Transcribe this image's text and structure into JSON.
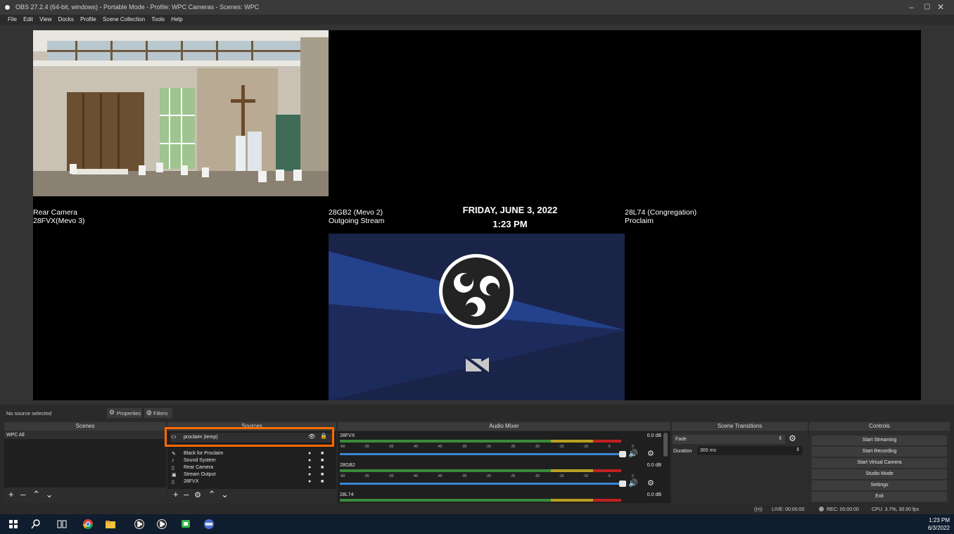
{
  "window": {
    "title": "OBS 27.2.4 (64-bit, windows) - Portable Mode - Profile: WPC Cameras - Scenes: WPC",
    "min": "–",
    "max": "▢",
    "close": "✕"
  },
  "menu": [
    "File",
    "Edit",
    "View",
    "Docks",
    "Profile",
    "Scene Collection",
    "Tools",
    "Help"
  ],
  "preview": {
    "left_label_1": "Rear Camera",
    "left_label_2": "28FVX(Mevo 3)",
    "mid_label_1": "28GB2 (Mevo 2)",
    "mid_label_2": "Outgoing Stream",
    "date": "FRIDAY, JUNE 3, 2022",
    "time": "1:23 PM",
    "right_label_1": "28L74 (Congregation)",
    "right_label_2": "Proclaim"
  },
  "propbar": {
    "status": "No source selected",
    "properties": "Properties",
    "filters": "Filters"
  },
  "scenes": {
    "header": "Scenes",
    "items": [
      "WPC All"
    ]
  },
  "sources": {
    "header": "Sources",
    "items": [
      "proclaim )temp)",
      "Black for Proclaim",
      "Sound System",
      "Rear Camera",
      "Stream Output",
      "28FVX"
    ]
  },
  "mixer": {
    "header": "Audio Mixer",
    "channels": [
      {
        "name": "28FVX",
        "db": "0.0 dB"
      },
      {
        "name": "28GB2",
        "db": "0.0 dB"
      },
      {
        "name": "28L74",
        "db": "0.0 dB"
      }
    ],
    "scale": [
      "-60",
      "-55",
      "-50",
      "-45",
      "-40",
      "-35",
      "-30",
      "-25",
      "-20",
      "-15",
      "-10",
      "-5",
      "0"
    ]
  },
  "transitions": {
    "header": "Scene Transitions",
    "selected": "Fade",
    "duration_label": "Duration",
    "duration_value": "300 ms"
  },
  "controls": {
    "header": "Controls",
    "buttons": [
      "Start Streaming",
      "Start Recording",
      "Start Virtual Camera",
      "Studio Mode",
      "Settings",
      "Exit"
    ]
  },
  "status": {
    "live": "LIVE: 00:00:00",
    "rec": "REC: 00:00:00",
    "cpu": "CPU: 3.7%, 30.00 fps"
  },
  "taskbar": {
    "time": "1:23 PM",
    "date": "6/3/2022"
  },
  "colors": {
    "accent": "#ff6a00",
    "canvas": "#000000",
    "meter_green": "#3a8a3a",
    "meter_yellow": "#b8a020",
    "meter_red": "#c02020",
    "slider_blue": "#3a86d8"
  }
}
